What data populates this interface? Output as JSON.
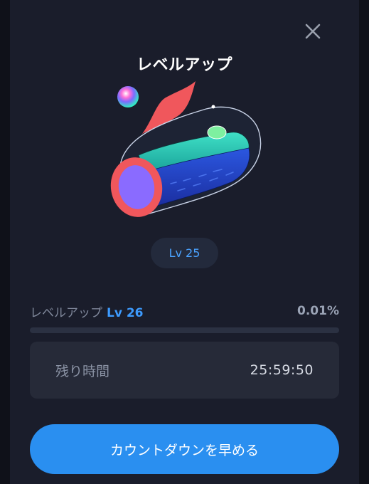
{
  "dialog": {
    "title": "レベルアップ",
    "current_level": "Lv 25",
    "close_icon": "close-icon"
  },
  "progress": {
    "label": "レベルアップ",
    "next_level": "Lv 26",
    "percent_text": "0.01%",
    "fraction": 0.0001
  },
  "timer": {
    "label": "残り時間",
    "value": "25:59:50"
  },
  "actions": {
    "speed_up_label": "カウントダウンを早める"
  },
  "colors": {
    "accent": "#3d9bff",
    "button": "#2a8ff0",
    "panel": "#1a1d2b"
  }
}
